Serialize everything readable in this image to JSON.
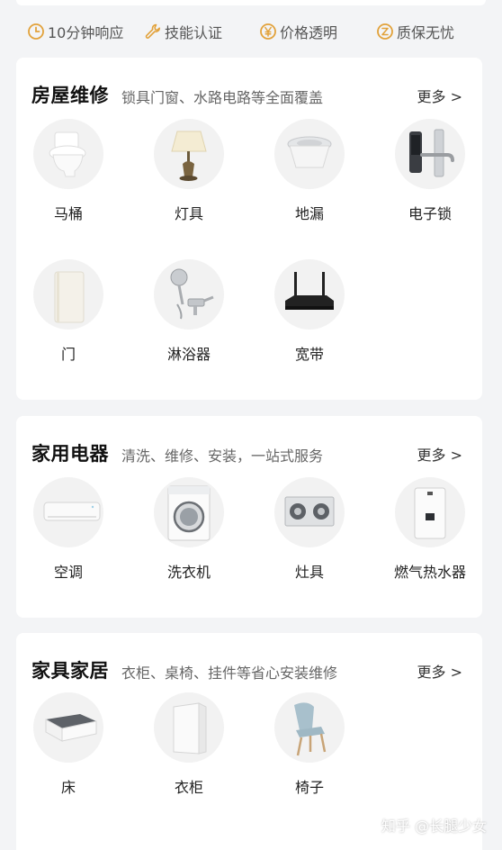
{
  "features": [
    {
      "label": "10分钟响应",
      "icon": "clock-icon"
    },
    {
      "label": "技能认证",
      "icon": "wrench-icon"
    },
    {
      "label": "价格透明",
      "icon": "yen-icon"
    },
    {
      "label": "质保无忧",
      "icon": "shield-z-icon"
    }
  ],
  "accent_color": "#e2a23b",
  "sections": [
    {
      "title": "房屋维修",
      "subtitle": "锁具门窗、水路电路等全面覆盖",
      "more": "更多 >",
      "items": [
        {
          "label": "马桶",
          "icon": "toilet-icon"
        },
        {
          "label": "灯具",
          "icon": "lamp-icon"
        },
        {
          "label": "地漏",
          "icon": "floor-drain-icon"
        },
        {
          "label": "电子锁",
          "icon": "smart-lock-icon"
        },
        {
          "label": "门",
          "icon": "door-icon"
        },
        {
          "label": "淋浴器",
          "icon": "shower-icon"
        },
        {
          "label": "宽带",
          "icon": "router-icon"
        }
      ]
    },
    {
      "title": "家用电器",
      "subtitle": "清洗、维修、安装，一站式服务",
      "more": "更多 >",
      "items": [
        {
          "label": "空调",
          "icon": "air-conditioner-icon"
        },
        {
          "label": "洗衣机",
          "icon": "washing-machine-icon"
        },
        {
          "label": "灶具",
          "icon": "stove-icon"
        },
        {
          "label": "燃气热水器",
          "icon": "water-heater-icon"
        }
      ]
    },
    {
      "title": "家具家居",
      "subtitle": "衣柜、桌椅、挂件等省心安装维修",
      "more": "更多 >",
      "items": [
        {
          "label": "床",
          "icon": "bed-icon"
        },
        {
          "label": "衣柜",
          "icon": "wardrobe-icon"
        },
        {
          "label": "椅子",
          "icon": "chair-icon"
        }
      ]
    }
  ],
  "watermark": "知乎 @长腿少女"
}
